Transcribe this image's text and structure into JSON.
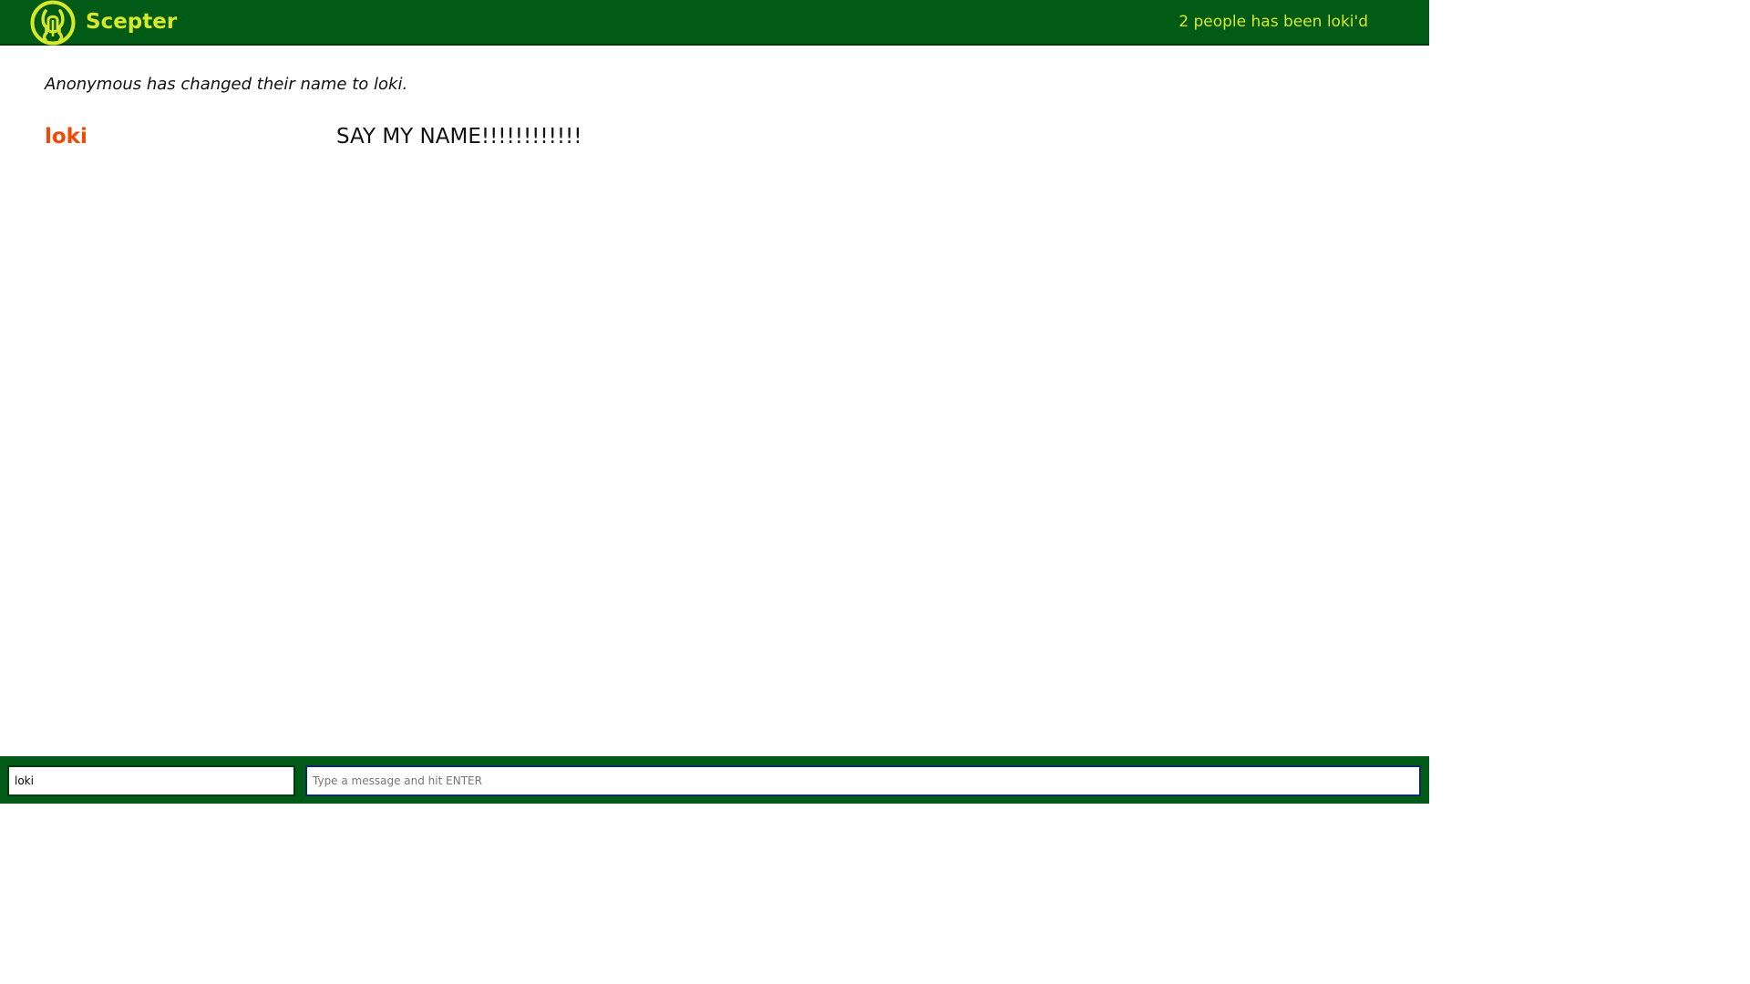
{
  "header": {
    "brand": "Scepter",
    "counter_text": "2 people has been loki'd",
    "logo_icon": "loki-helmet-icon"
  },
  "colors": {
    "header_bg": "#015b17",
    "accent": "#d6ea2a",
    "username": "#ef4b06"
  },
  "chat": {
    "system_message": "Anonymous has changed their name to loki.",
    "messages": [
      {
        "user": "loki",
        "text": "SAY MY NAME!!!!!!!!!!!!"
      }
    ]
  },
  "composer": {
    "name_value": "loki",
    "message_value": "",
    "message_placeholder": "Type a message and hit ENTER"
  }
}
